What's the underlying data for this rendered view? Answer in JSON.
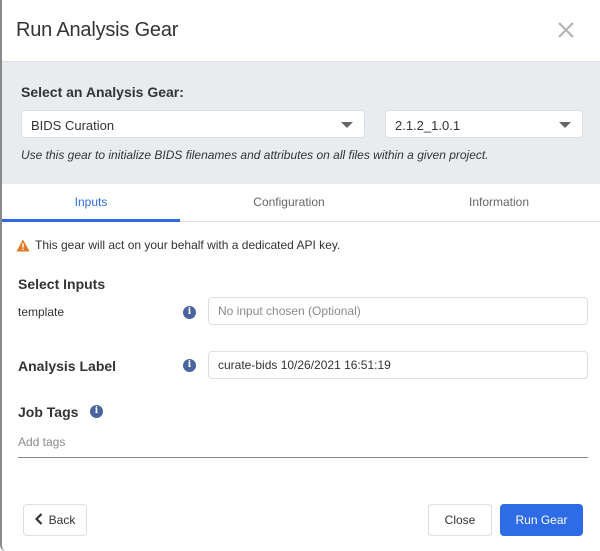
{
  "modal": {
    "title": "Run Analysis Gear",
    "close_icon": "close-icon"
  },
  "gear_selector": {
    "heading": "Select an Analysis Gear:",
    "gear_value": "BIDS Curation",
    "version_value": "2.1.2_1.0.1",
    "description": "Use this gear to initialize BIDS filenames and attributes on all files within a given project."
  },
  "tabs": [
    {
      "label": "Inputs",
      "active": true
    },
    {
      "label": "Configuration",
      "active": false
    },
    {
      "label": "Information",
      "active": false
    }
  ],
  "warning": {
    "icon": "warning-icon",
    "text": "This gear will act on your behalf with a dedicated API key."
  },
  "inputs": {
    "section_title": "Select Inputs",
    "fields": [
      {
        "label": "template",
        "placeholder": "No input chosen (Optional)",
        "value": ""
      }
    ]
  },
  "analysis_label": {
    "label": "Analysis Label",
    "value": "curate-bids 10/26/2021 16:51:19"
  },
  "job_tags": {
    "label": "Job Tags",
    "placeholder": "Add tags"
  },
  "footer": {
    "back_label": "Back",
    "close_label": "Close",
    "run_label": "Run Gear"
  },
  "colors": {
    "accent": "#2e6be6",
    "panel_bg": "#e9ecef",
    "warning": "#e07b24",
    "info": "#4a64a0"
  }
}
